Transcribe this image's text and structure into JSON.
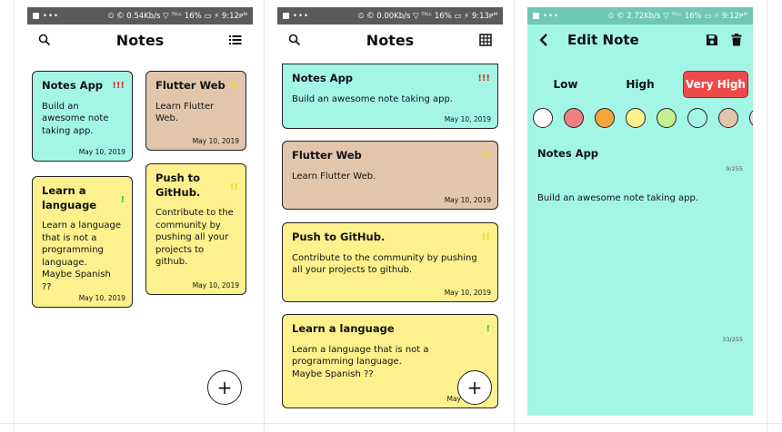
{
  "panel1": {
    "status": {
      "left": "•••",
      "right": "⏲ © 0.54Kb/s ▽ ᵀᵗᴸᴸ 16% ▭ ⚡ 9:12ᴘᴹ"
    },
    "title": "Notes",
    "icons": [
      "search-icon",
      "list-view-icon"
    ],
    "notes": [
      {
        "title": "Notes App",
        "body": "Build an awesome note taking app.",
        "date": "May 10, 2019",
        "priority": "!!!",
        "color": "#a3f6e6"
      },
      {
        "title": "Flutter Web",
        "body": "Learn Flutter Web.",
        "date": "May 10, 2019",
        "priority": "!!",
        "color": "#e2c6ab"
      },
      {
        "title": "Learn a language",
        "body": "Learn a language that is not a programming language.\nMaybe Spanish ??",
        "date": "May 10, 2019",
        "priority": "!",
        "color": "#fcf18d"
      },
      {
        "title": "Push to GitHub.",
        "body": "Contribute to the community by pushing all your projects to github.",
        "date": "May 10, 2019",
        "priority": "!!",
        "color": "#fcf18d"
      }
    ],
    "fab": "+"
  },
  "panel2": {
    "status": {
      "left": "•••",
      "right": "⏲ © 0.00Kb/s ▽ ᵀᵗᴸᴸ 16% ▭ ⚡ 9:13ᴘᴹ"
    },
    "title": "Notes",
    "icons": [
      "search-icon",
      "grid-view-icon"
    ],
    "notes": [
      {
        "title": "Notes App",
        "body": "Build an awesome note taking app.",
        "date": "May 10, 2019",
        "priority": "!!!",
        "color": "#a3f6e6"
      },
      {
        "title": "Flutter Web",
        "body": "Learn Flutter Web.",
        "date": "May 10, 2019",
        "priority": "!!",
        "color": "#e2c6ab"
      },
      {
        "title": "Push to GitHub.",
        "body": "Contribute to the community by pushing all your projects to github.",
        "date": "May 10, 2019",
        "priority": "!!",
        "color": "#fcf18d"
      },
      {
        "title": "Learn a language",
        "body": "Learn a language that is not a programming language.\nMaybe Spanish ??",
        "date": "May",
        "priority": "!",
        "color": "#fcf18d"
      }
    ],
    "fab": "+"
  },
  "panel3": {
    "status": {
      "left": "•••",
      "right": "⏲ © 2.72Kb/s ▽ ᵀᵗᴸᴸ 16% ▭ ⚡ 9:12ᴘᴹ"
    },
    "title": "Edit Note",
    "icons": [
      "back-icon",
      "save-icon",
      "delete-icon"
    ],
    "priorities": [
      {
        "label": "Low",
        "active": false
      },
      {
        "label": "High",
        "active": false
      },
      {
        "label": "Very High",
        "active": true
      }
    ],
    "colors": [
      "#ffffff",
      "#f08080",
      "#f5a53a",
      "#fcf18d",
      "#c4ee90",
      "#a3f6e6",
      "#e2c6ab",
      "#e0e0e0"
    ],
    "selected_color": "#a3f6e6",
    "note_title": "Notes App",
    "title_count": "9/255",
    "note_body": "Build an awesome note taking app.",
    "body_count": "33/255"
  }
}
